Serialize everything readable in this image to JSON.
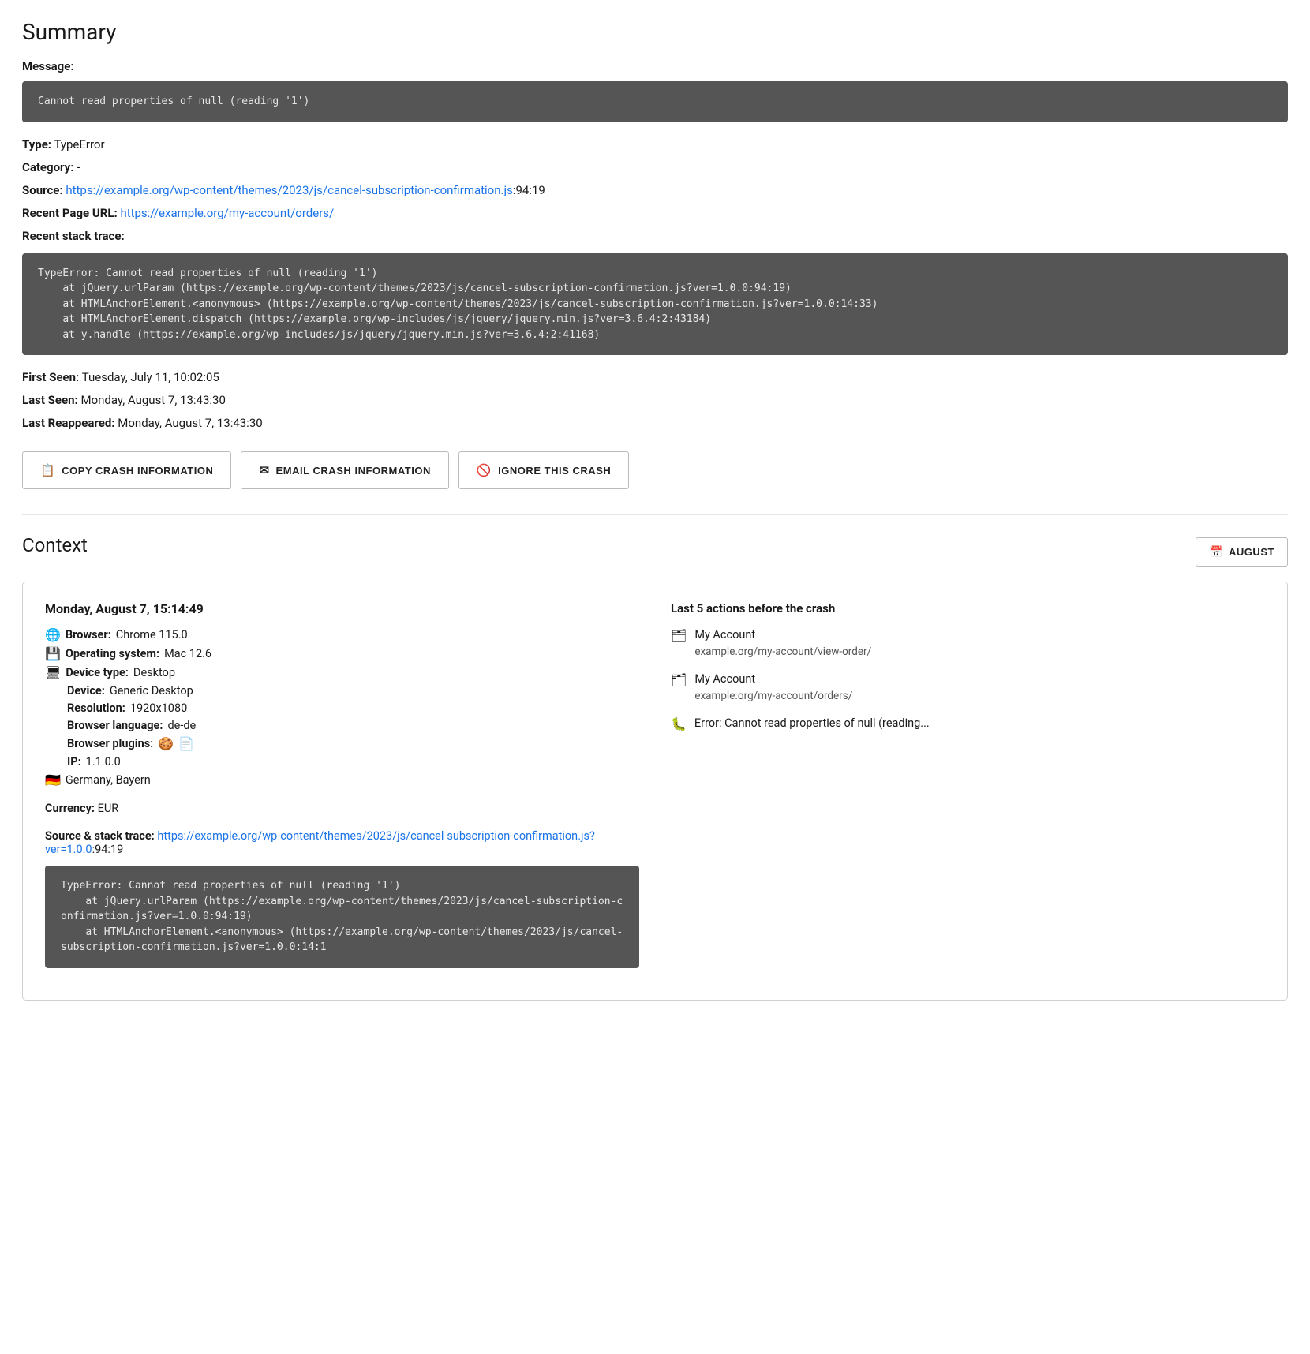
{
  "summary": {
    "title": "Summary",
    "message_label": "Message:",
    "message_code": "Cannot read properties of null (reading '1')",
    "type_label": "Type:",
    "type_value": "TypeError",
    "category_label": "Category:",
    "category_value": "-",
    "source_label": "Source:",
    "source_url": "https://example.org/wp-content/themes/2023/js/cancel-subscription-confirmation.js",
    "source_suffix": ":94:19",
    "recent_page_label": "Recent Page URL:",
    "recent_page_url": "https://example.org/my-account/orders/",
    "stack_label": "Recent stack trace:",
    "stack_trace": "TypeError: Cannot read properties of null (reading '1')\n    at jQuery.urlParam (https://example.org/wp-content/themes/2023/js/cancel-subscription-confirmation.js?ver=1.0.0:94:19)\n    at HTMLAnchorElement.<anonymous> (https://example.org/wp-content/themes/2023/js/cancel-subscription-confirmation.js?ver=1.0.0:14:33)\n    at HTMLAnchorElement.dispatch (https://example.org/wp-includes/js/jquery/jquery.min.js?ver=3.6.4:2:43184)\n    at y.handle (https://example.org/wp-includes/js/jquery/jquery.min.js?ver=3.6.4:2:41168)",
    "first_seen_label": "First Seen:",
    "first_seen_value": "Tuesday, July 11, 10:02:05",
    "last_seen_label": "Last Seen:",
    "last_seen_value": "Monday, August 7, 13:43:30",
    "last_reappeared_label": "Last Reappeared:",
    "last_reappeared_value": "Monday, August 7, 13:43:30"
  },
  "actions": {
    "copy_label": "COPY CRASH INFORMATION",
    "email_label": "EMAIL CRASH INFORMATION",
    "ignore_label": "IGNORE THIS CRASH"
  },
  "context": {
    "title": "Context",
    "august_btn_label": "AUGUST",
    "card": {
      "date": "Monday, August 7, 15:14:49",
      "browser_label": "Browser:",
      "browser_value": "Chrome 115.0",
      "os_label": "Operating system:",
      "os_value": "Mac 12.6",
      "device_type_label": "Device type:",
      "device_type_value": "Desktop",
      "device_label": "Device:",
      "device_value": "Generic Desktop",
      "resolution_label": "Resolution:",
      "resolution_value": "1920x1080",
      "browser_lang_label": "Browser language:",
      "browser_lang_value": "de-de",
      "browser_plugins_label": "Browser plugins:",
      "ip_label": "IP:",
      "ip_value": "1.1.0.0",
      "location_value": "Germany, Bayern",
      "currency_label": "Currency:",
      "currency_value": "EUR",
      "source_label": "Source & stack trace:",
      "source_url": "https://example.org/wp-content/themes/2023/js/cancel-subscription-confirmation.js?ver=1.0.0",
      "source_suffix": ":94:19",
      "stack_trace": "TypeError: Cannot read properties of null (reading '1')\n    at jQuery.urlParam (https://example.org/wp-content/themes/2023/js/cancel-subscription-confirmation.js?ver=1.0.0:94:19)\n    at HTMLAnchorElement.<anonymous> (https://example.org/wp-content/themes/2023/js/cancel-subscription-confirmation.js?ver=1.0.0:14:1",
      "actions_title": "Last 5 actions before the crash",
      "actions_list": [
        {
          "type": "page",
          "name": "My Account",
          "url": "example.org/my-account/view-order/"
        },
        {
          "type": "page",
          "name": "My Account",
          "url": "example.org/my-account/orders/"
        },
        {
          "type": "error",
          "text": "Error: Cannot read properties of null (reading..."
        }
      ]
    }
  }
}
